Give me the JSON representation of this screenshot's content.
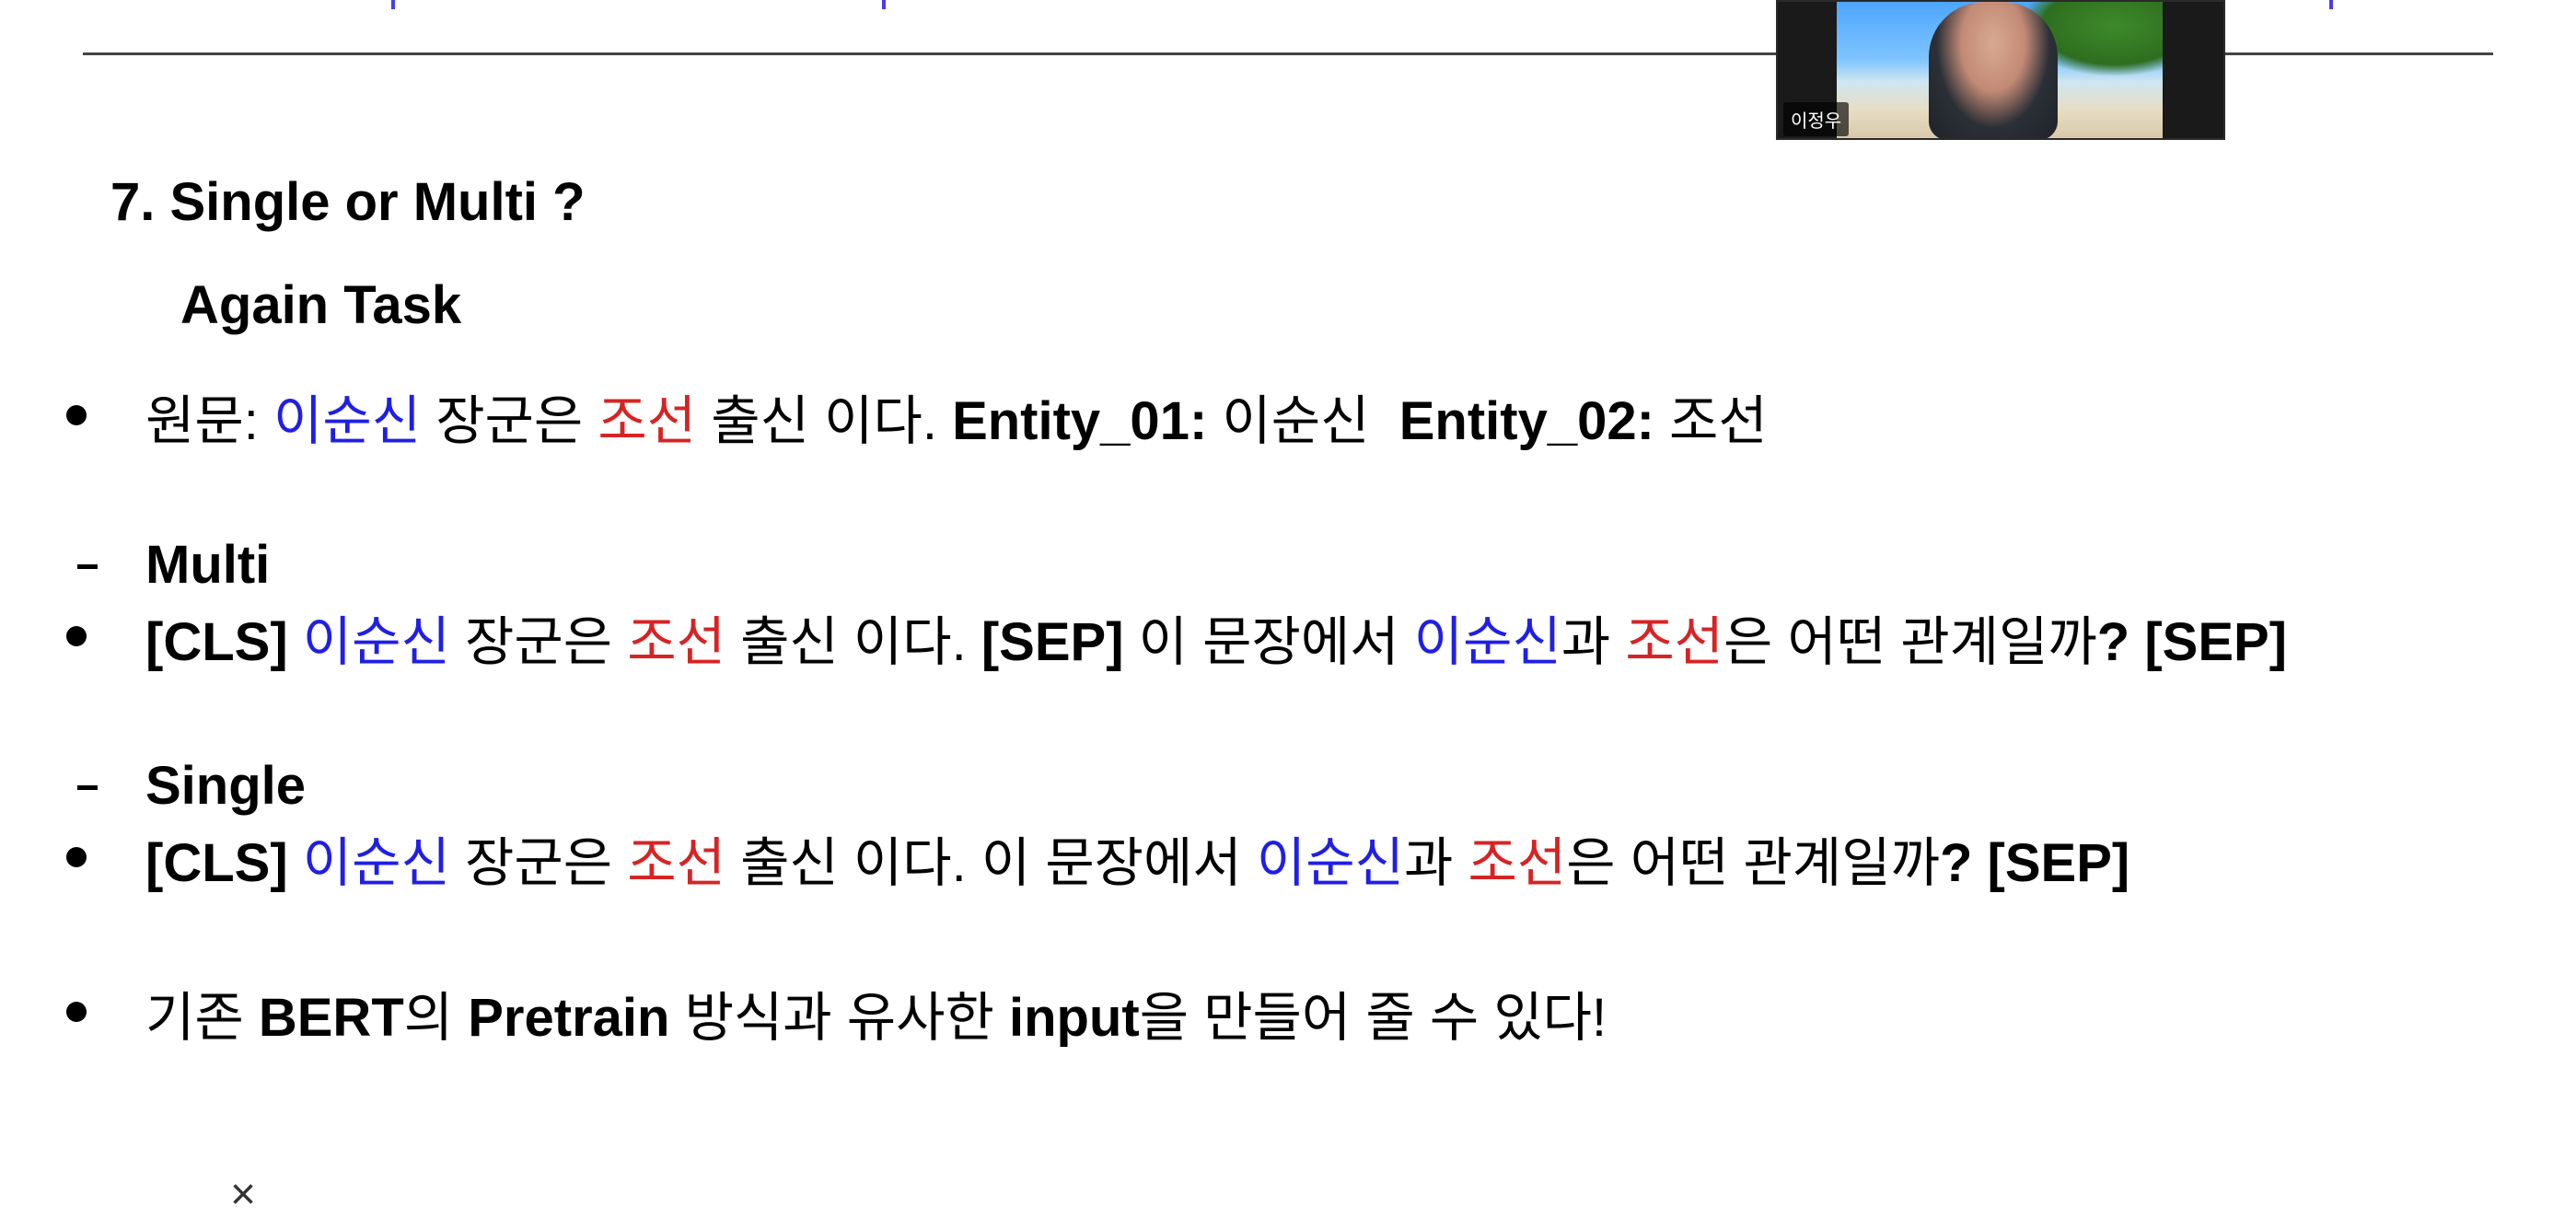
{
  "participant": {
    "name": "이정우"
  },
  "slide": {
    "title": "7.   Single or Multi ?",
    "subtitle": "Again Task",
    "original": {
      "label": "원문:",
      "ent1": "이순신",
      "t1": "장군은",
      "ent2": "조선",
      "t2": "출신 이다.",
      "e01_label": "Entity_01:",
      "e01_value": "이순신",
      "e02_label": "Entity_02:",
      "e02_value": "조선"
    },
    "multi": {
      "label": "Multi",
      "cls": "[CLS]",
      "ent1": "이순신",
      "t1": "장군은",
      "ent2": "조선",
      "t2": "출신 이다.",
      "sep1": "[SEP]",
      "t3": "이 문장에서",
      "ent1b": "이순신",
      "t4": "과",
      "ent2b": "조선",
      "t5": "은 어떤 관계일까",
      "end": "? [SEP]"
    },
    "single": {
      "label": "Single",
      "cls": "[CLS]",
      "ent1": "이순신",
      "t1": "장군은",
      "ent2": "조선",
      "t2": "출신 이다. 이 문장에서",
      "ent1b": "이순신",
      "t3": "과",
      "ent2b": "조선",
      "t4": "은 어떤 관계일까",
      "end": "? [SEP]"
    },
    "conclusion": {
      "p1": "기존",
      "p2": "BERT",
      "p3": "의",
      "p4": "Pretrain",
      "p5": "방식과 유사한",
      "p6": "input",
      "p7": "을 만들어 줄 수 있다!"
    }
  },
  "close_label": "×",
  "colors": {
    "entity_1": "#1f1fe6",
    "entity_2": "#d62424"
  }
}
